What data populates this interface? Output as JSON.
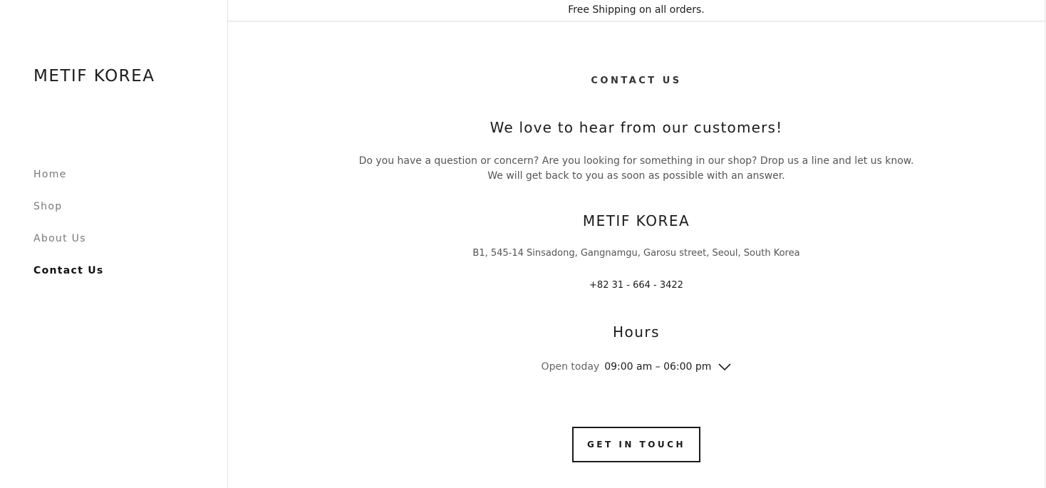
{
  "banner": {
    "text": "Free Shipping on all orders."
  },
  "sidebar": {
    "brand": "METIF KOREA",
    "nav": [
      {
        "label": "Home",
        "active": false
      },
      {
        "label": "Shop",
        "active": false
      },
      {
        "label": "About Us",
        "active": false
      },
      {
        "label": "Contact Us",
        "active": true
      }
    ]
  },
  "contact": {
    "eyebrow": "CONTACT US",
    "headline": "We love to hear from our customers!",
    "body_line1": "Do you have a question or concern? Are you looking for something in our shop? Drop us a line and let us know.",
    "body_line2": "We will get back to you as soon as possible with an answer.",
    "business_name": "METIF KOREA",
    "address": "B1, 545-14 Sinsadong, Gangnamgu, Garosu street, Seoul, South Korea",
    "phone": "+82 31 - 664 - 3422",
    "hours_title": "Hours",
    "open_today_label": "Open today",
    "open_today_hours": "09:00 am – 06:00 pm",
    "expand_icon": "chevron-down-icon",
    "cta_label": "GET IN TOUCH"
  },
  "colors": {
    "text": "#1b1b1b",
    "muted": "#7a7a7a",
    "border": "#e6e6e6"
  }
}
